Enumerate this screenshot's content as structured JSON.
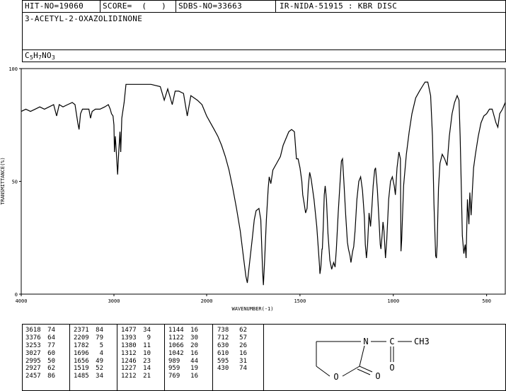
{
  "header": {
    "hit_no": "HIT-NO=19060",
    "score": "SCORE=  (   )",
    "sdbs_no": "SDBS-NO=33663",
    "ir_no": "IR-NIDA-51915 : KBR DISC",
    "compound_name": "3-ACETYL-2-OXAZOLIDINONE",
    "formula_c": "C",
    "formula_c_sub": "5",
    "formula_h": "H",
    "formula_h_sub": "7",
    "formula_rest": "NO",
    "formula_o_sub": "3"
  },
  "chart_data": {
    "type": "line",
    "xlabel": "WAVENUMBER(-1)",
    "ylabel": "TRANSMITTANCE(%)",
    "xlim": [
      4000,
      400
    ],
    "ylim": [
      0,
      100
    ],
    "x_ticks": [
      "4000",
      "3000",
      "2000",
      "1500",
      "1000",
      "500"
    ],
    "y_ticks": [
      "0",
      "50",
      "100"
    ],
    "series": [
      {
        "values": [
          [
            4000,
            81
          ],
          [
            3950,
            82
          ],
          [
            3900,
            81
          ],
          [
            3850,
            82
          ],
          [
            3800,
            83
          ],
          [
            3750,
            82
          ],
          [
            3700,
            83
          ],
          [
            3650,
            84
          ],
          [
            3618,
            79
          ],
          [
            3590,
            84
          ],
          [
            3550,
            83
          ],
          [
            3500,
            84
          ],
          [
            3450,
            85
          ],
          [
            3420,
            84
          ],
          [
            3390,
            76
          ],
          [
            3376,
            73
          ],
          [
            3360,
            80
          ],
          [
            3340,
            82
          ],
          [
            3300,
            82
          ],
          [
            3270,
            82
          ],
          [
            3253,
            78
          ],
          [
            3235,
            81
          ],
          [
            3200,
            82
          ],
          [
            3150,
            82
          ],
          [
            3100,
            83
          ],
          [
            3060,
            84
          ],
          [
            3040,
            82
          ],
          [
            3027,
            80
          ],
          [
            3010,
            79
          ],
          [
            3000,
            75
          ],
          [
            2995,
            63
          ],
          [
            2985,
            70
          ],
          [
            2970,
            60
          ],
          [
            2960,
            53
          ],
          [
            2950,
            62
          ],
          [
            2935,
            72
          ],
          [
            2927,
            63
          ],
          [
            2915,
            78
          ],
          [
            2890,
            85
          ],
          [
            2870,
            93
          ],
          [
            2800,
            93
          ],
          [
            2700,
            93
          ],
          [
            2600,
            93
          ],
          [
            2500,
            92
          ],
          [
            2457,
            86
          ],
          [
            2420,
            91
          ],
          [
            2371,
            84
          ],
          [
            2340,
            90
          ],
          [
            2300,
            90
          ],
          [
            2250,
            89
          ],
          [
            2209,
            79
          ],
          [
            2170,
            88
          ],
          [
            2100,
            86
          ],
          [
            2050,
            84
          ],
          [
            2000,
            79
          ],
          [
            1980,
            76
          ],
          [
            1960,
            73
          ],
          [
            1940,
            70
          ],
          [
            1920,
            66
          ],
          [
            1900,
            61
          ],
          [
            1880,
            55
          ],
          [
            1860,
            47
          ],
          [
            1840,
            38
          ],
          [
            1820,
            28
          ],
          [
            1805,
            18
          ],
          [
            1790,
            8
          ],
          [
            1782,
            5
          ],
          [
            1770,
            14
          ],
          [
            1755,
            25
          ],
          [
            1745,
            33
          ],
          [
            1735,
            37
          ],
          [
            1720,
            38
          ],
          [
            1710,
            33
          ],
          [
            1700,
            10
          ],
          [
            1696,
            4
          ],
          [
            1690,
            14
          ],
          [
            1680,
            33
          ],
          [
            1670,
            47
          ],
          [
            1665,
            52
          ],
          [
            1656,
            49
          ],
          [
            1645,
            55
          ],
          [
            1625,
            58
          ],
          [
            1605,
            61
          ],
          [
            1590,
            66
          ],
          [
            1575,
            69
          ],
          [
            1560,
            72
          ],
          [
            1545,
            73
          ],
          [
            1530,
            72
          ],
          [
            1519,
            60
          ],
          [
            1510,
            60
          ],
          [
            1500,
            56
          ],
          [
            1490,
            50
          ],
          [
            1485,
            44
          ],
          [
            1477,
            40
          ],
          [
            1470,
            36
          ],
          [
            1462,
            38
          ],
          [
            1455,
            48
          ],
          [
            1448,
            54
          ],
          [
            1440,
            51
          ],
          [
            1425,
            42
          ],
          [
            1410,
            30
          ],
          [
            1400,
            18
          ],
          [
            1395,
            12
          ],
          [
            1393,
            9
          ],
          [
            1388,
            12
          ],
          [
            1382,
            20
          ],
          [
            1380,
            20
          ],
          [
            1375,
            30
          ],
          [
            1370,
            44
          ],
          [
            1365,
            48
          ],
          [
            1358,
            42
          ],
          [
            1350,
            27
          ],
          [
            1340,
            15
          ],
          [
            1330,
            11
          ],
          [
            1320,
            14
          ],
          [
            1312,
            12
          ],
          [
            1305,
            20
          ],
          [
            1295,
            36
          ],
          [
            1285,
            50
          ],
          [
            1278,
            59
          ],
          [
            1272,
            60
          ],
          [
            1265,
            50
          ],
          [
            1255,
            35
          ],
          [
            1246,
            23
          ],
          [
            1240,
            20
          ],
          [
            1232,
            17
          ],
          [
            1227,
            14
          ],
          [
            1218,
            19
          ],
          [
            1212,
            21
          ],
          [
            1205,
            28
          ],
          [
            1195,
            42
          ],
          [
            1185,
            50
          ],
          [
            1175,
            52
          ],
          [
            1165,
            46
          ],
          [
            1155,
            34
          ],
          [
            1150,
            22
          ],
          [
            1144,
            16
          ],
          [
            1138,
            22
          ],
          [
            1130,
            36
          ],
          [
            1122,
            30
          ],
          [
            1115,
            38
          ],
          [
            1108,
            48
          ],
          [
            1100,
            55
          ],
          [
            1095,
            56
          ],
          [
            1085,
            46
          ],
          [
            1075,
            30
          ],
          [
            1070,
            22
          ],
          [
            1066,
            20
          ],
          [
            1060,
            26
          ],
          [
            1055,
            32
          ],
          [
            1050,
            28
          ],
          [
            1042,
            16
          ],
          [
            1035,
            24
          ],
          [
            1025,
            42
          ],
          [
            1015,
            50
          ],
          [
            1005,
            52
          ],
          [
            995,
            48
          ],
          [
            989,
            44
          ],
          [
            980,
            56
          ],
          [
            970,
            63
          ],
          [
            962,
            60
          ],
          [
            959,
            19
          ],
          [
            955,
            24
          ],
          [
            945,
            48
          ],
          [
            930,
            62
          ],
          [
            915,
            72
          ],
          [
            900,
            80
          ],
          [
            880,
            87
          ],
          [
            860,
            90
          ],
          [
            845,
            92
          ],
          [
            830,
            94
          ],
          [
            815,
            94
          ],
          [
            800,
            88
          ],
          [
            790,
            70
          ],
          [
            782,
            40
          ],
          [
            773,
            17
          ],
          [
            769,
            16
          ],
          [
            765,
            22
          ],
          [
            758,
            47
          ],
          [
            750,
            58
          ],
          [
            738,
            62
          ],
          [
            725,
            60
          ],
          [
            712,
            57
          ],
          [
            700,
            70
          ],
          [
            685,
            80
          ],
          [
            672,
            85
          ],
          [
            658,
            88
          ],
          [
            648,
            86
          ],
          [
            642,
            70
          ],
          [
            636,
            48
          ],
          [
            630,
            26
          ],
          [
            622,
            18
          ],
          [
            615,
            22
          ],
          [
            610,
            16
          ],
          [
            603,
            42
          ],
          [
            598,
            35
          ],
          [
            595,
            31
          ],
          [
            590,
            45
          ],
          [
            583,
            35
          ],
          [
            577,
            45
          ],
          [
            570,
            56
          ],
          [
            560,
            62
          ],
          [
            545,
            70
          ],
          [
            530,
            76
          ],
          [
            515,
            79
          ],
          [
            500,
            80
          ],
          [
            485,
            82
          ],
          [
            470,
            82
          ],
          [
            450,
            76
          ],
          [
            440,
            74
          ],
          [
            430,
            80
          ],
          [
            415,
            82
          ],
          [
            400,
            85
          ]
        ]
      }
    ]
  },
  "peak_table": {
    "columns": [
      [
        [
          "3618",
          "74"
        ],
        [
          "3376",
          "64"
        ],
        [
          "3253",
          "77"
        ],
        [
          "3027",
          "60"
        ],
        [
          "2995",
          "50"
        ],
        [
          "2927",
          "62"
        ],
        [
          "2457",
          "86"
        ]
      ],
      [
        [
          "2371",
          "84"
        ],
        [
          "2209",
          "79"
        ],
        [
          "1782",
          "5"
        ],
        [
          "1696",
          "4"
        ],
        [
          "1656",
          "49"
        ],
        [
          "1519",
          "52"
        ],
        [
          "1485",
          "34"
        ]
      ],
      [
        [
          "1477",
          "34"
        ],
        [
          "1393",
          "9"
        ],
        [
          "1380",
          "11"
        ],
        [
          "1312",
          "10"
        ],
        [
          "1246",
          "23"
        ],
        [
          "1227",
          "14"
        ],
        [
          "1212",
          "21"
        ]
      ],
      [
        [
          "1144",
          "16"
        ],
        [
          "1122",
          "30"
        ],
        [
          "1066",
          "20"
        ],
        [
          "1042",
          "16"
        ],
        [
          "989",
          "44"
        ],
        [
          "959",
          "19"
        ],
        [
          "769",
          "16"
        ]
      ],
      [
        [
          "738",
          "62"
        ],
        [
          "712",
          "57"
        ],
        [
          "630",
          "26"
        ],
        [
          "610",
          "16"
        ],
        [
          "595",
          "31"
        ],
        [
          "430",
          "74"
        ]
      ]
    ]
  },
  "structure": {
    "n": "N",
    "c": "C",
    "ch3": "CH3",
    "o_carbonyl_ring": "O",
    "o_carbonyl_acetyl": "O",
    "o_ring": "O"
  }
}
